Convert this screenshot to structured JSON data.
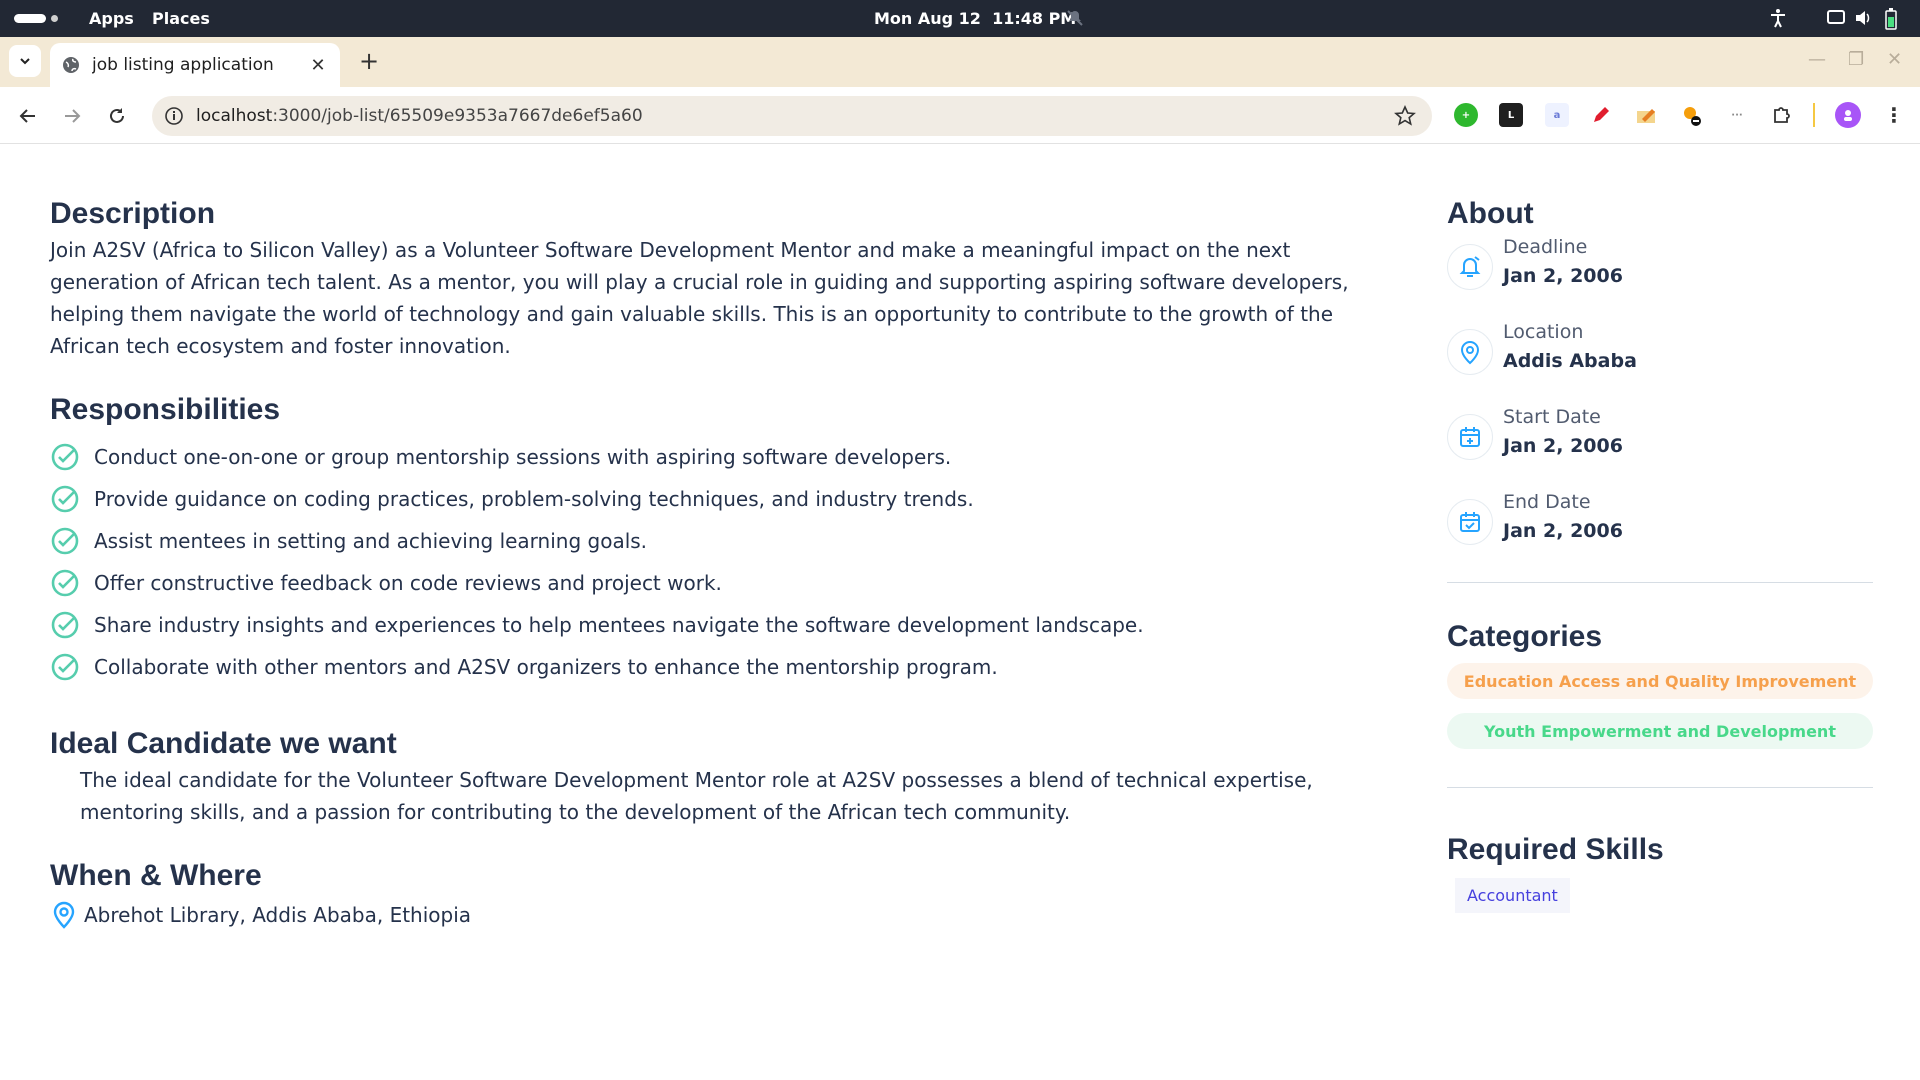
{
  "system_bar": {
    "apps_label": "Apps",
    "places_label": "Places",
    "datetime": "Mon Aug 12  11:48 PM"
  },
  "browser": {
    "tab_title": "job listing application",
    "url_host": "localhost",
    "url_path": ":3000/job-list/65509e9353a7667de6ef5a60"
  },
  "page": {
    "description": {
      "heading": "Description",
      "text": "Join A2SV (Africa to Silicon Valley) as a Volunteer Software Development Mentor and make a meaningful impact on the next generation of African tech talent. As a mentor, you will play a crucial role in guiding and supporting aspiring software developers, helping them navigate the world of technology and gain valuable skills. This is an opportunity to contribute to the growth of the African tech ecosystem and foster innovation."
    },
    "responsibilities": {
      "heading": "Responsibilities",
      "items": [
        "Conduct one-on-one or group mentorship sessions with aspiring software developers.",
        "Provide guidance on coding practices, problem-solving techniques, and industry trends.",
        "Assist mentees in setting and achieving learning goals.",
        "Offer constructive feedback on code reviews and project work.",
        "Share industry insights and experiences to help mentees navigate the software development landscape.",
        "Collaborate with other mentors and A2SV organizers to enhance the mentorship program."
      ]
    },
    "ideal_candidate": {
      "heading": "Ideal Candidate we want",
      "text": "The ideal candidate for the Volunteer Software Development Mentor role at A2SV possesses a blend of technical expertise, mentoring skills, and a passion for contributing to the development of the African tech community."
    },
    "when_where": {
      "heading": "When & Where",
      "location": "Abrehot Library, Addis Ababa, Ethiopia"
    },
    "about": {
      "heading": "About",
      "items": [
        {
          "label": "Deadline",
          "value": "Jan 2, 2006",
          "icon": "alarm-icon"
        },
        {
          "label": "Location",
          "value": "Addis Ababa",
          "icon": "location-pin-icon"
        },
        {
          "label": "Start Date",
          "value": "Jan 2, 2006",
          "icon": "calendar-plus-icon"
        },
        {
          "label": "End Date",
          "value": "Jan 2, 2006",
          "icon": "calendar-check-icon"
        }
      ]
    },
    "categories": {
      "heading": "Categories",
      "items": [
        {
          "label": "Education Access and Quality Improvement",
          "color": "#f6a04c"
        },
        {
          "label": "Youth Empowerment and Development",
          "color": "#48d88a"
        }
      ]
    },
    "required_skills": {
      "heading": "Required Skills",
      "items": [
        "Accountant"
      ]
    }
  },
  "colors": {
    "accent_teal": "#26a4ff",
    "check_green": "#56cdad",
    "heading_navy": "#25324b"
  }
}
